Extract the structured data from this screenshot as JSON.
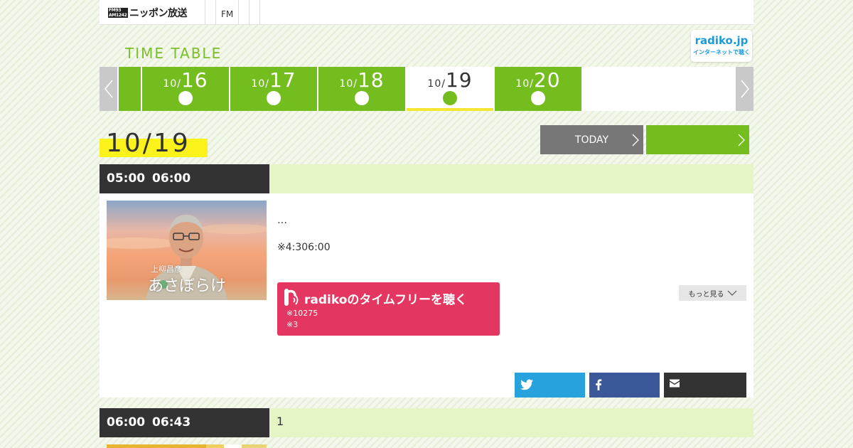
{
  "header": {
    "logo_line1": "FM93",
    "logo_line2": "AM1242",
    "logo_text": "ニッポン放送",
    "nav_fm": "FM"
  },
  "title": "TIME TABLE",
  "radiko_badge": {
    "name": "radiko.jp",
    "tagline": "インターネットで聴く"
  },
  "tabs": [
    {
      "month": "10/",
      "day": "16",
      "active": false
    },
    {
      "month": "10/",
      "day": "17",
      "active": false
    },
    {
      "month": "10/",
      "day": "18",
      "active": false
    },
    {
      "month": "10/",
      "day": "19",
      "active": true
    },
    {
      "month": "10/",
      "day": "20",
      "active": false
    }
  ],
  "date_heading": "10/19",
  "today_label": "TODAY",
  "colors": {
    "accent_green": "#74bd1f",
    "highlight_yellow": "#fbf21b",
    "radiko_pink": "#e33761",
    "twitter": "#28a2dc",
    "facebook": "#3b5898"
  },
  "programs": [
    {
      "start": "05:00",
      "end": "06:00",
      "title": "",
      "thumbnail_caption_small": "上柳昌彦",
      "thumbnail_caption_large": "あさぼらけ",
      "desc1": "…",
      "desc2": "※4:306:00",
      "radiko_label": "radikoのタイムフリーを聴く",
      "radiko_note1": "※10275",
      "radiko_note2": "※3",
      "more_label": "もっと見る"
    },
    {
      "start": "06:00",
      "end": "06:43",
      "title": "1"
    }
  ]
}
